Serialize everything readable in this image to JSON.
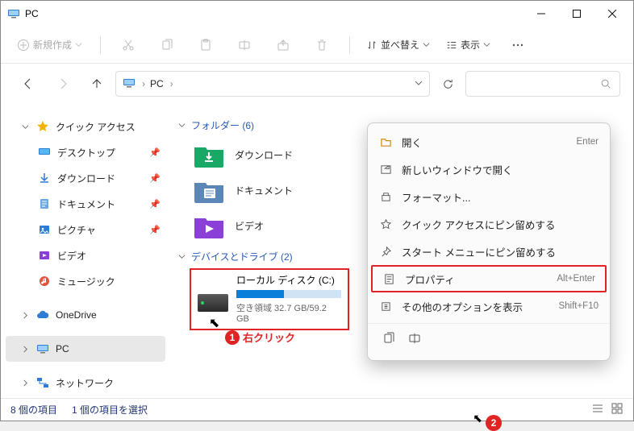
{
  "title": "PC",
  "toolbar": {
    "new": "新規作成",
    "sort": "並べ替え",
    "view": "表示"
  },
  "breadcrumb": {
    "root": "PC",
    "sep": "›"
  },
  "side": {
    "quick": "クイック アクセス",
    "desktop": "デスクトップ",
    "downloads": "ダウンロード",
    "documents": "ドキュメント",
    "pictures": "ピクチャ",
    "videos": "ビデオ",
    "music": "ミュージック",
    "onedrive": "OneDrive",
    "pc": "PC",
    "network": "ネットワーク"
  },
  "main": {
    "folders_header": "フォルダー (6)",
    "folder_download": "ダウンロード",
    "folder_document": "ドキュメント",
    "folder_video": "ビデオ",
    "drives_header": "デバイスとドライブ (2)",
    "drive_name": "ローカル ディスク (C:)",
    "drive_free": "空き領域 32.7 GB/59.2 GB",
    "drive_used_pct": 45
  },
  "ctx": {
    "open": "開く",
    "open_sc": "Enter",
    "newwin": "新しいウィンドウで開く",
    "format": "フォーマット...",
    "pin_quick": "クイック アクセスにピン留めする",
    "pin_start": "スタート メニューにピン留めする",
    "prop": "プロパティ",
    "prop_sc": "Alt+Enter",
    "more": "その他のオプションを表示",
    "more_sc": "Shift+F10"
  },
  "callout": {
    "one_num": "1",
    "one_text": "右クリック",
    "two_num": "2"
  },
  "status": {
    "items": "8 個の項目",
    "selected": "1 個の項目を選択"
  }
}
